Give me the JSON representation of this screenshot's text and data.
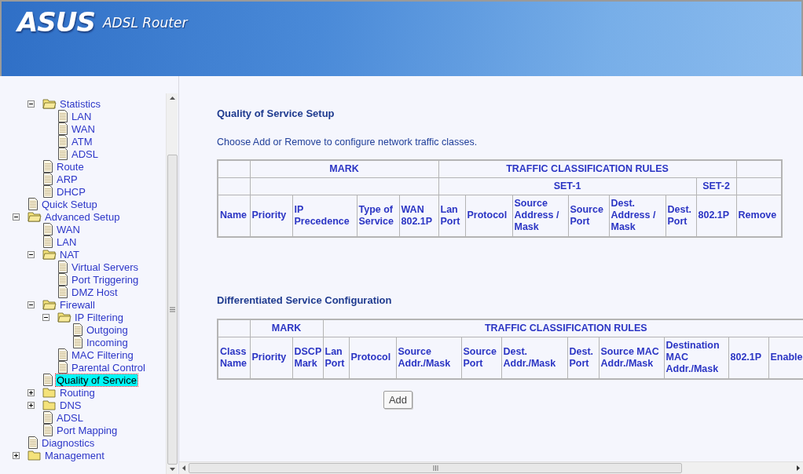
{
  "header": {
    "logo": "ASUS",
    "product": "ADSL Router"
  },
  "tree": {
    "partial_branch": [
      {
        "label": "Statistics",
        "kind": "folder",
        "expanded": true,
        "selected": false,
        "children": [
          {
            "label": "LAN",
            "kind": "page",
            "selected": false
          },
          {
            "label": "WAN",
            "kind": "page",
            "selected": false
          },
          {
            "label": "ATM",
            "kind": "page",
            "selected": false
          },
          {
            "label": "ADSL",
            "kind": "page",
            "selected": false
          }
        ]
      },
      {
        "label": "Route",
        "kind": "page",
        "selected": false
      },
      {
        "label": "ARP",
        "kind": "page",
        "selected": false
      },
      {
        "label": "DHCP",
        "kind": "page",
        "selected": false
      }
    ],
    "items": [
      {
        "label": "Quick Setup",
        "kind": "page",
        "selected": false
      },
      {
        "label": "Advanced Setup",
        "kind": "folder",
        "expanded": true,
        "selected": false,
        "children": [
          {
            "label": "WAN",
            "kind": "page",
            "selected": false
          },
          {
            "label": "LAN",
            "kind": "page",
            "selected": false
          },
          {
            "label": "NAT",
            "kind": "folder",
            "expanded": true,
            "selected": false,
            "children": [
              {
                "label": "Virtual Servers",
                "kind": "page",
                "selected": false
              },
              {
                "label": "Port Triggering",
                "kind": "page",
                "selected": false
              },
              {
                "label": "DMZ Host",
                "kind": "page",
                "selected": false
              }
            ]
          },
          {
            "label": "Firewall",
            "kind": "folder",
            "expanded": true,
            "selected": false,
            "children": [
              {
                "label": "IP Filtering",
                "kind": "folder",
                "expanded": true,
                "selected": false,
                "children": [
                  {
                    "label": "Outgoing",
                    "kind": "page",
                    "selected": false
                  },
                  {
                    "label": "Incoming",
                    "kind": "page",
                    "selected": false
                  }
                ]
              },
              {
                "label": "MAC Filtering",
                "kind": "page",
                "selected": false
              },
              {
                "label": "Parental Control",
                "kind": "page",
                "selected": false
              }
            ]
          },
          {
            "label": "Quality of Service",
            "kind": "page",
            "selected": true
          },
          {
            "label": "Routing",
            "kind": "folder",
            "expanded": false,
            "selected": false
          },
          {
            "label": "DNS",
            "kind": "folder",
            "expanded": false,
            "selected": false
          },
          {
            "label": "ADSL",
            "kind": "page",
            "selected": false
          },
          {
            "label": "Port Mapping",
            "kind": "page",
            "selected": false
          }
        ]
      },
      {
        "label": "Diagnostics",
        "kind": "page",
        "selected": false
      },
      {
        "label": "Management",
        "kind": "folder",
        "expanded": false,
        "selected": false
      }
    ]
  },
  "qos_setup": {
    "title": "Quality of Service Setup",
    "intro": "Choose Add or Remove to configure network traffic classes.",
    "table": {
      "name_column": "Name",
      "mark": {
        "label": "MARK",
        "columns": [
          "Priority",
          "IP Precedence",
          "Type of Service",
          "WAN 802.1P"
        ]
      },
      "rules": {
        "label": "TRAFFIC CLASSIFICATION RULES",
        "set_1": {
          "label": "SET-1",
          "columns": [
            "Lan Port",
            "Protocol",
            "Source Address / Mask",
            "Source Port",
            "Dest. Address / Mask",
            "Dest. Port"
          ]
        },
        "set_2": {
          "label": "SET-2",
          "columns": [
            "802.1P"
          ]
        }
      },
      "remove_column": "Remove"
    }
  },
  "diffserv": {
    "title": "Differentiated Service Configuration",
    "table": {
      "name_column": "Class Name",
      "mark": {
        "label": "MARK",
        "columns": [
          "Priority",
          "DSCP Mark"
        ]
      },
      "rules": {
        "label": "TRAFFIC CLASSIFICATION RULES",
        "columns": [
          "Lan Port",
          "Protocol",
          "Source Addr./Mask",
          "Source Port",
          "Dest. Addr./Mask",
          "Dest. Port",
          "Source MAC Addr./Mask",
          "Destination MAC Addr./Mask",
          "802.1P",
          "Enable"
        ]
      }
    },
    "add_button": "Add"
  }
}
